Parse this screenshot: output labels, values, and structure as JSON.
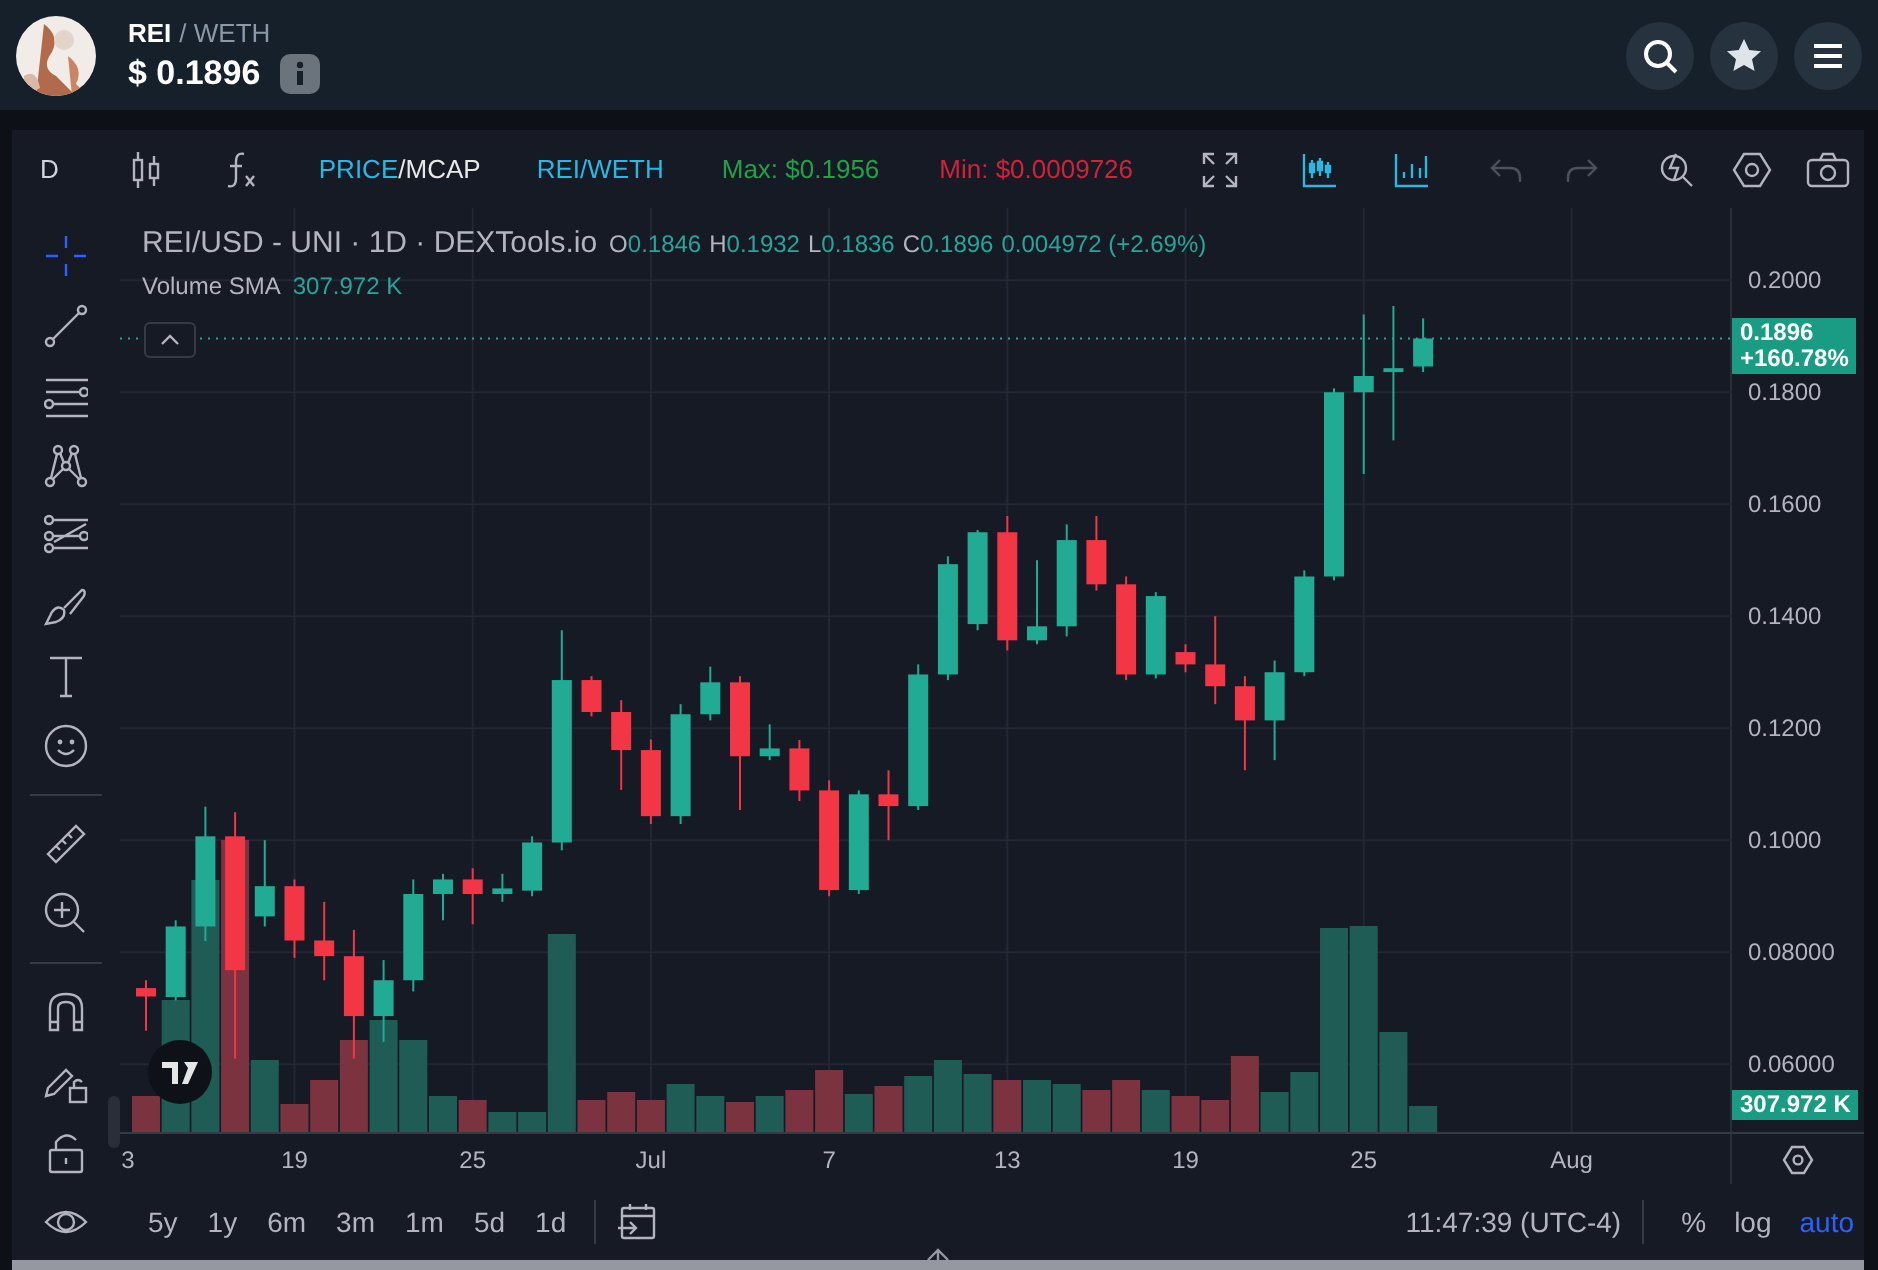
{
  "header": {
    "base": "REI",
    "quote": "/ WETH",
    "price": "$ 0.1896"
  },
  "toolbar": {
    "interval": "D",
    "price_toggle": [
      {
        "label": "PRICE",
        "selected": true
      },
      {
        "label": "MCAP",
        "selected": false
      }
    ],
    "separator": "/",
    "pair": "REI/WETH",
    "max": "Max: $0.1956",
    "min": "Min: $0.0009726",
    "history": [
      {
        "kind": "undo",
        "disabled": true
      },
      {
        "kind": "redo",
        "disabled": true
      }
    ]
  },
  "legend": {
    "symbol": "REI/USD - UNI · 1D · DEXTools.io",
    "ohlc": [
      {
        "key": "O",
        "value": "0.1846"
      },
      {
        "key": "H",
        "value": "0.1932"
      },
      {
        "key": "L",
        "value": "0.1836"
      },
      {
        "key": "C",
        "value": "0.1896"
      }
    ],
    "change": "0.004972 (+2.69%)",
    "indicator": "Volume SMA",
    "indicator_value": "307.972 K"
  },
  "chart": {
    "last_price": "0.1896",
    "last_change": "+160.78%",
    "volume_label": "307.972 K",
    "price_axis": [
      "0.2000",
      "0.1800",
      "0.1600",
      "0.1400",
      "0.1200",
      "0.1000",
      "0.08000",
      "0.06000"
    ],
    "time_axis": [
      "3",
      "19",
      "25",
      "Jul",
      "7",
      "13",
      "19",
      "25",
      "Aug"
    ]
  },
  "bottom_bar": {
    "ranges": [
      "5y",
      "1y",
      "6m",
      "3m",
      "1m",
      "5d",
      "1d"
    ],
    "time": "11:47:39 (UTC-4)",
    "scale_options": [
      {
        "label": "%",
        "selected": false
      },
      {
        "label": "log",
        "selected": false
      },
      {
        "label": "auto",
        "selected": true
      }
    ]
  }
}
